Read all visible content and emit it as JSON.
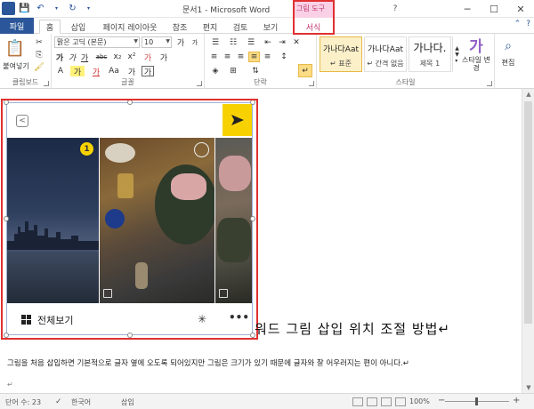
{
  "title_bar": {
    "title": "문서1 - Microsoft Word",
    "context_group": "그림 도구",
    "minimize": "─",
    "maximize": "☐",
    "close": "✕"
  },
  "tabs": {
    "file": "파일",
    "items": [
      "홈",
      "삽입",
      "페이지 레이아웃",
      "참조",
      "편지",
      "검토",
      "보기",
      "서식"
    ],
    "active": "홈",
    "context_tab": "서식"
  },
  "ribbon": {
    "clipboard": {
      "paste": "붙여넣기",
      "label": "클립보드"
    },
    "font": {
      "name": "맑은 고딕 (본문)",
      "size": "10",
      "label": "글꼴",
      "bold": "가",
      "italic": "가",
      "underline": "가",
      "strike": "abc",
      "subscript": "x₂",
      "superscript": "x²",
      "clear": "가",
      "phonetic": "가",
      "highlight_a": "가",
      "aa": "Aa",
      "grow": "가",
      "shrink": "가"
    },
    "paragraph": {
      "label": "단락"
    },
    "styles": {
      "label": "스타일",
      "items": [
        {
          "preview": "가나다Aat",
          "name": "↵ 표준"
        },
        {
          "preview": "가나다Aat",
          "name": "↵ 간격 없음"
        },
        {
          "preview": "가나다.",
          "name": "제목 1"
        }
      ],
      "change": "스타일 변경"
    },
    "editing": {
      "label": "편집"
    }
  },
  "document": {
    "heading": "워드 그림 삽입 위치 조절 방법↵",
    "paragraph": "그림을 처음 삽입하면 기본적으로 글자 옆에 오도록 되어있지만 그림은 크기가 있기 때문에 글자와 잘 어우러지는 편이 아니다.↵",
    "empty_para": "↵"
  },
  "image": {
    "badge": "1",
    "view_all": "전체보기",
    "more": "•••",
    "back": "<",
    "send": "▶"
  },
  "status_bar": {
    "word_count": "단어 수: 23",
    "language": "한국어",
    "mode": "삽입",
    "zoom": "100%"
  },
  "colors": {
    "file_tab": "#2b579a",
    "context": "#f9d0e5",
    "highlight": "#e03030",
    "accent_yellow": "#f7d200"
  }
}
